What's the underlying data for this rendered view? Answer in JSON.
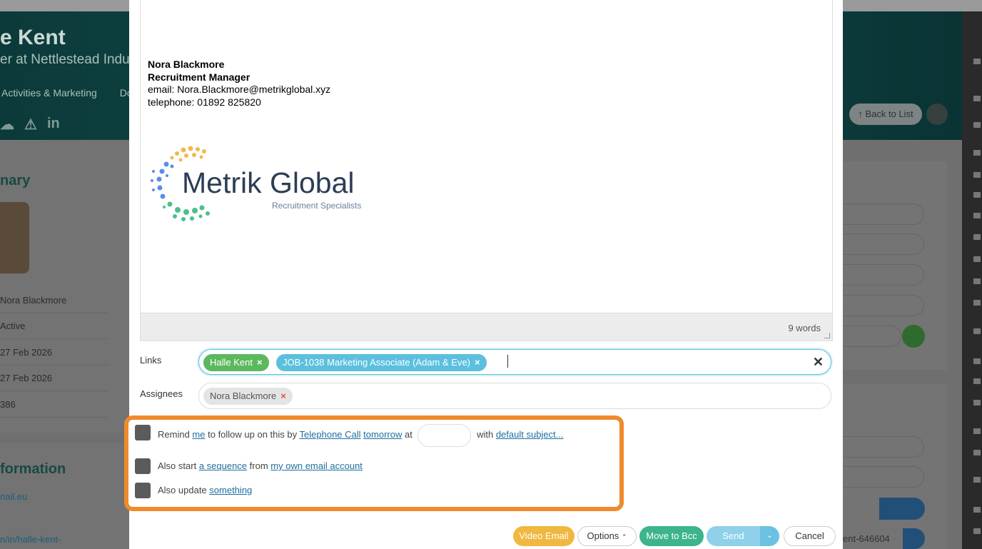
{
  "background": {
    "contact": {
      "name": "e Kent",
      "role": "er at Nettlestead Indus"
    },
    "tabs": [
      "Activities & Marketing",
      "Do"
    ],
    "back_button": "Back to List",
    "summary_title": "nary",
    "summary_rows": [
      "Nora Blackmore",
      "Active",
      "27 Feb 2026",
      "27 Feb 2026",
      "386"
    ],
    "info_title": "formation",
    "info_rows": [
      "nail.eu",
      "n/in/halle-kent-"
    ],
    "right_field_text": "ent-646604"
  },
  "editor": {
    "signature": {
      "name": "Nora Blackmore",
      "title": "Recruitment Manager",
      "email": "email: Nora.Blackmore@metrikglobal.xyz",
      "telephone": "telephone: 01892 825820"
    },
    "logo": {
      "name": "Metrik Global",
      "tagline": "Recruitment Specialists"
    },
    "word_count": "9 words"
  },
  "links": {
    "label": "Links",
    "tags": [
      "Halle Kent",
      "JOB-1038 Marketing Associate (Adam & Eve)"
    ],
    "remove_glyph": "×",
    "clear_glyph": "✕"
  },
  "assignees": {
    "label": "Assignees",
    "tags": [
      "Nora Blackmore"
    ]
  },
  "options": {
    "remind": {
      "prefix": "Remind",
      "who": "me",
      "mid1": "to follow up on this by",
      "method": "Telephone Call",
      "when": "tomorrow",
      "at": "at",
      "with": "with",
      "subject": "default subject..."
    },
    "sequence": {
      "prefix": "Also start",
      "link1": "a sequence",
      "mid": "from",
      "link2": "my own email account"
    },
    "update": {
      "prefix": "Also update",
      "link": "something"
    }
  },
  "buttons": {
    "video": "Video Email",
    "options": "Options",
    "options_caret": "⌃",
    "bcc": "Move to Bcc",
    "send": "Send",
    "send_caret": "⌄",
    "cancel": "Cancel"
  },
  "colors": {
    "accent_orange": "#f08a2c",
    "link_blue": "#1f6f9e",
    "tag_green": "#5cb85c",
    "tag_blue": "#5bc0de"
  }
}
